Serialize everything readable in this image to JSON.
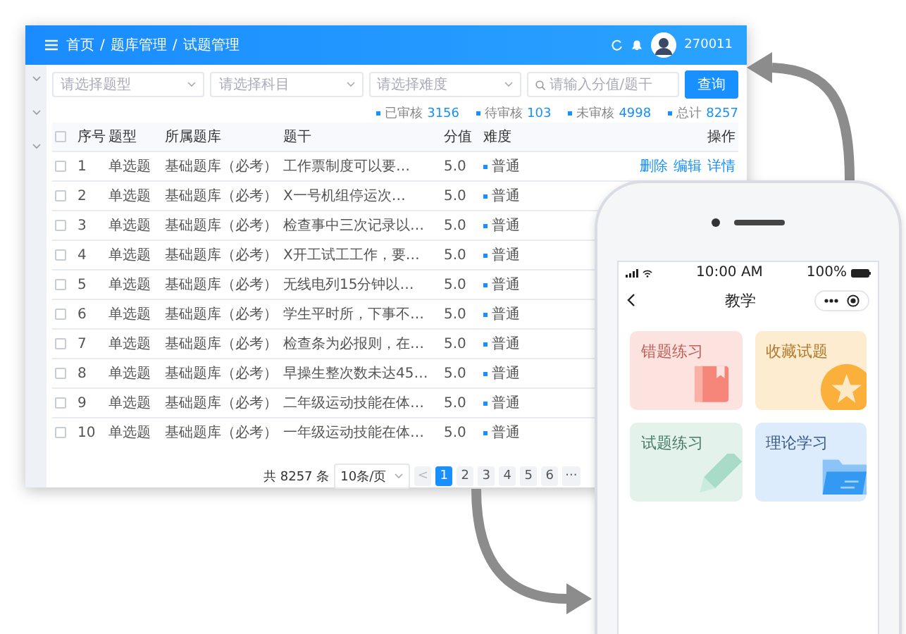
{
  "dashboard": {
    "header": {
      "breadcrumb": [
        "首页",
        "题库管理",
        "试题管理"
      ],
      "separator": "/",
      "username": "270011"
    },
    "filters": {
      "selects": [
        "请选择题型",
        "请选择科目",
        "请选择难度"
      ],
      "search": {
        "placeholder": "请输入分值/题干"
      },
      "button": "查询"
    },
    "stats": [
      {
        "label": "已审核",
        "value": "3156"
      },
      {
        "label": "待审核",
        "value": "103"
      },
      {
        "label": "未审核",
        "value": "4998"
      },
      {
        "label": "总计",
        "value": "8257"
      }
    ],
    "table": {
      "all_checked": false,
      "columns": [
        "序号",
        "题型",
        "所属题库",
        "题干",
        "分值",
        "难度",
        "操作"
      ],
      "rows": [
        {
          "checked": false,
          "cells": [
            "1",
            "单选题",
            "基础题库（必考）",
            "工作票制度可以要…",
            "5.0",
            "普通"
          ],
          "actions": [
            "删除",
            "编辑",
            "详情"
          ]
        },
        {
          "checked": false,
          "cells": [
            "2",
            "单选题",
            "基础题库（必考）",
            "X一号机组停运次…",
            "5.0",
            "普通"
          ]
        },
        {
          "checked": false,
          "cells": [
            "3",
            "单选题",
            "基础题库（必考）",
            "检查事中三次记录以…",
            "5.0",
            "普通"
          ]
        },
        {
          "checked": false,
          "cells": [
            "4",
            "单选题",
            "基础题库（必考）",
            "X开工试工工作，要…",
            "5.0",
            "普通"
          ]
        },
        {
          "checked": false,
          "cells": [
            "5",
            "单选题",
            "基础题库（必考）",
            "无线电列15分钟以…",
            "5.0",
            "普通"
          ]
        },
        {
          "checked": false,
          "cells": [
            "6",
            "单选题",
            "基础题库（必考）",
            "学生平时所，下事不…",
            "5.0",
            "普通"
          ]
        },
        {
          "checked": false,
          "cells": [
            "7",
            "单选题",
            "基础题库（必考）",
            "检查条为必报则，在…",
            "5.0",
            "普通"
          ]
        },
        {
          "checked": false,
          "cells": [
            "8",
            "单选题",
            "基础题库（必考）",
            "早操生整次数未达45…",
            "5.0",
            "普通"
          ]
        },
        {
          "checked": false,
          "cells": [
            "9",
            "单选题",
            "基础题库（必考）",
            "二年级运动技能在体…",
            "5.0",
            "普通"
          ]
        },
        {
          "checked": false,
          "cells": [
            "10",
            "单选题",
            "基础题库（必考）",
            "一年级运动技能在体…",
            "5.0",
            "普通"
          ]
        }
      ]
    },
    "pagination": {
      "total": "共 8257 条",
      "page_size": "10条/页",
      "prev": "<",
      "pages": [
        {
          "label": "1",
          "selected": true
        },
        {
          "label": "2",
          "selected": false
        },
        {
          "label": "3",
          "selected": false
        },
        {
          "label": "4",
          "selected": false
        },
        {
          "label": "5",
          "selected": false
        },
        {
          "label": "6",
          "selected": false
        }
      ],
      "more": "···"
    }
  },
  "phone": {
    "status_bar": {
      "time": "10:00 AM",
      "battery": "100%"
    },
    "title": "教学",
    "cards": [
      {
        "label": "错题练习",
        "kind": "book",
        "color": "#fde3df"
      },
      {
        "label": "收藏试题",
        "kind": "star",
        "color": "#fdecd0"
      },
      {
        "label": "试题练习",
        "kind": "pencil",
        "color": "#e3f3ec"
      },
      {
        "label": "理论学习",
        "kind": "folder",
        "color": "#dcecfc"
      }
    ]
  }
}
